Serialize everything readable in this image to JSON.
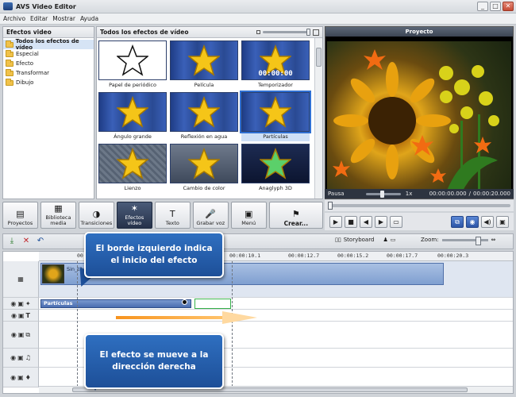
{
  "window": {
    "title": "AVS Video Editor",
    "controls": [
      "_",
      "□",
      "✕"
    ]
  },
  "menu": [
    "Archivo",
    "Editar",
    "Mostrar",
    "Ayuda"
  ],
  "left_panel": {
    "title": "Efectos video",
    "categories": [
      {
        "label": "Todos los efectos de vídeo",
        "selected": true
      },
      {
        "label": "Especial"
      },
      {
        "label": "Efecto"
      },
      {
        "label": "Transformar"
      },
      {
        "label": "Dibujo"
      }
    ]
  },
  "effects_panel": {
    "title": "Todos los efectos de vídeo",
    "effects": [
      {
        "label": "Papel de periódico",
        "style": "white"
      },
      {
        "label": "Película",
        "style": "blue"
      },
      {
        "label": "Temporizador",
        "style": "blue",
        "overlay": "00:00:00"
      },
      {
        "label": "Ángulo grande",
        "style": "blue"
      },
      {
        "label": "Reflexión en agua",
        "style": "blue"
      },
      {
        "label": "Partículas",
        "style": "blue",
        "selected": true
      },
      {
        "label": "Lienzo",
        "style": "stone"
      },
      {
        "label": "Cambio de color",
        "style": "gray"
      },
      {
        "label": "Anaglyph 3D",
        "style": "dark"
      }
    ]
  },
  "preview": {
    "title": "Proyecto",
    "status_label": "Pausa",
    "speed": "1x",
    "time_current": "00:00:00.000",
    "time_separator": "/",
    "time_total": "00:00:20.000"
  },
  "toolbar": [
    {
      "label": "Proyectos",
      "icon": "projects-icon"
    },
    {
      "label": "Biblioteca\nmedia",
      "icon": "media-library-icon"
    },
    {
      "label": "Transiciones",
      "icon": "transitions-icon"
    },
    {
      "label": "Efectos\nvídeo",
      "icon": "effects-icon",
      "active": true
    },
    {
      "label": "Texto",
      "icon": "text-icon"
    },
    {
      "label": "Grabar voz",
      "icon": "microphone-icon"
    },
    {
      "label": "Menú",
      "icon": "menu-icon"
    },
    {
      "label": "Crear...",
      "icon": "create-icon",
      "wide": true
    }
  ],
  "timeline_toolbar": {
    "storyboard_label": "Storyboard",
    "zoom_label": "Zoom:"
  },
  "timeline": {
    "ruler_ticks": [
      "00:00:",
      "00:00:10.1",
      "00:00:12.7",
      "00:00:15.2",
      "00:00:17.7",
      "00:00:20.3"
    ],
    "video_clip_label": "Sin_títu",
    "effect_clip_label": "Partículas"
  },
  "annotations": {
    "callout_1": "El borde izquierdo indica el inicio del efecto",
    "callout_2": "El efecto se mueve a la dirección derecha"
  },
  "colors": {
    "accent": "#2f6fc0",
    "arrow": "#f7931e",
    "star": "#f5c518"
  }
}
